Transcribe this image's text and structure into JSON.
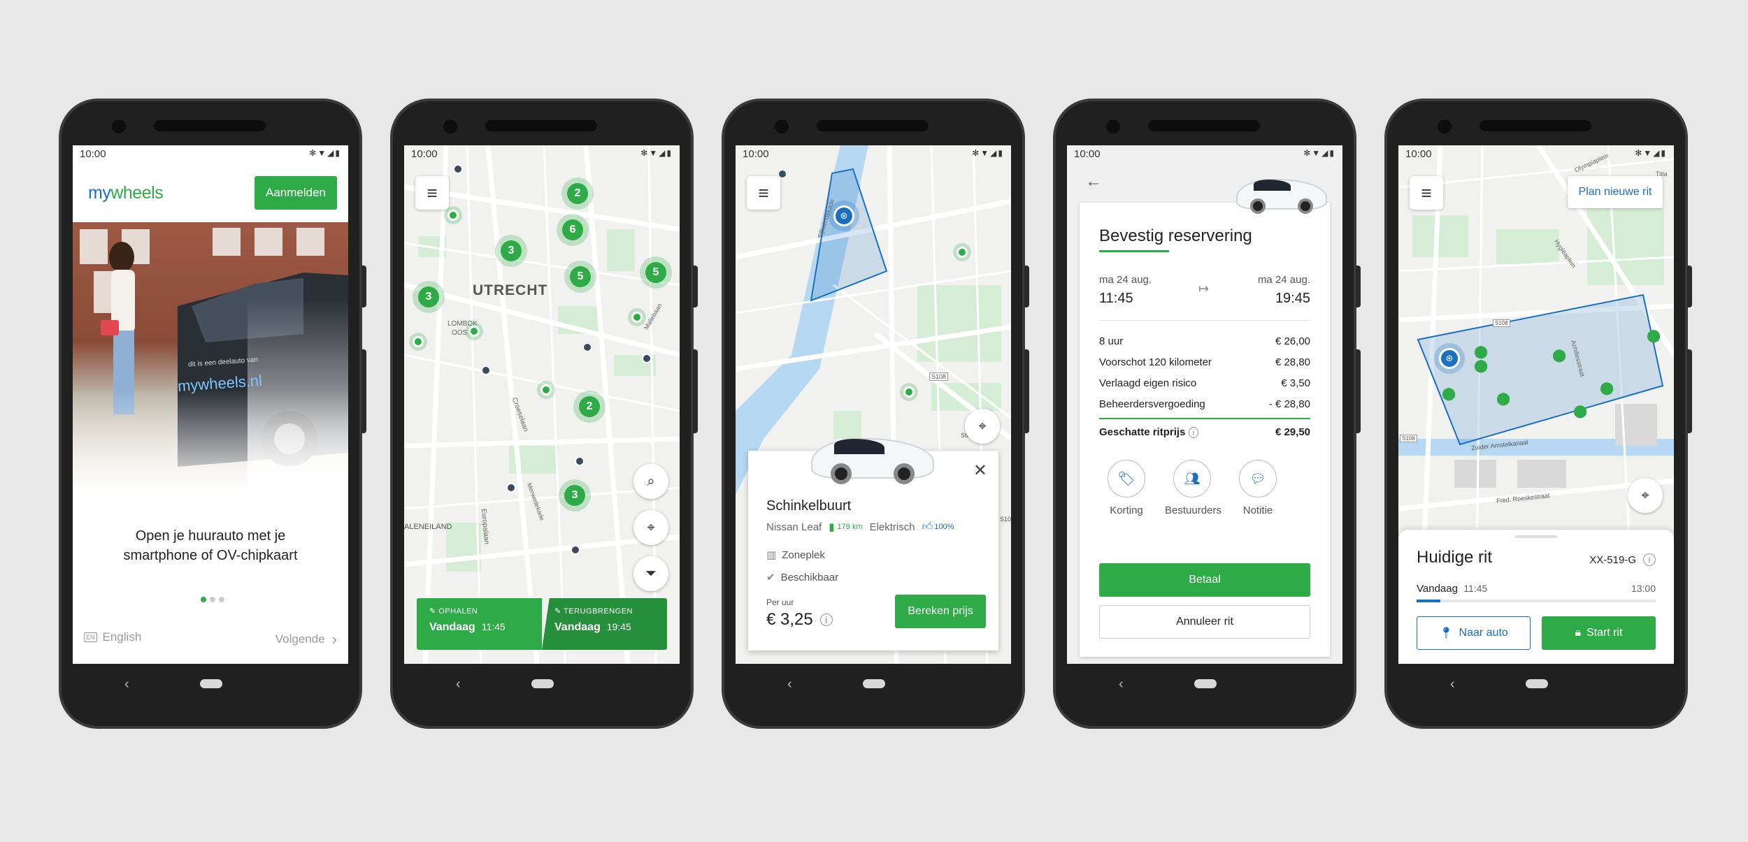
{
  "status_time": "10:00",
  "p1": {
    "logo_part1": "my",
    "logo_part2": "wheels",
    "login_button": "Aanmelden",
    "car_text1": "dit is een deelauto van",
    "car_text2": "mywheels.nl",
    "tagline": "Open je huurauto met je smartphone of OV-chipkaart",
    "lang_badge": "EN",
    "lang_label": "English",
    "next_label": "Volgende"
  },
  "p2": {
    "city_label": "UTRECHT",
    "clusters": [
      "2",
      "6",
      "3",
      "5",
      "5",
      "3",
      "2",
      "3"
    ],
    "street_labels": [
      "LOMBOK",
      "OOST",
      "Croeselaan",
      "Europalaan",
      "Merwedekade",
      "ALENEILAND",
      "Maliebaan"
    ],
    "pickup_label": "OPHALEN",
    "pickup_day": "Vandaag",
    "pickup_time": "11:45",
    "return_label": "TERUGBRENGEN",
    "return_day": "Vandaag",
    "return_time": "19:45"
  },
  "p3": {
    "street_labels": [
      "Sijtwendekade",
      "S108",
      "S10",
      "Sta"
    ],
    "location_name": "Schinkelbuurt",
    "car_model": "Nissan Leaf",
    "range": "179 km",
    "fuel": "Elektrisch",
    "rating": "100%",
    "zone_label": "Zoneplek",
    "availability": "Beschikbaar",
    "price_caption": "Per uur",
    "price": "€ 3,25",
    "calc_button": "Bereken prijs"
  },
  "p4": {
    "title": "Bevestig reservering",
    "start_date": "ma 24 aug.",
    "start_time": "11:45",
    "end_date": "ma 24 aug.",
    "end_time": "19:45",
    "lines": [
      {
        "label": "8 uur",
        "value": "€ 26,00"
      },
      {
        "label": "Voorschot 120 kilometer",
        "value": "€ 28,80"
      },
      {
        "label": "Verlaagd eigen risico",
        "value": "€ 3,50"
      },
      {
        "label": "Beheerdersvergoeding",
        "value": "- € 28,80"
      }
    ],
    "total_label": "Geschatte ritprijs",
    "total_value": "€ 29,50",
    "actions": [
      "Korting",
      "Bestuurders",
      "Notitie"
    ],
    "pay_button": "Betaal",
    "cancel_button": "Annuleer rit"
  },
  "p5": {
    "plan_button": "Plan nieuwe rit",
    "street_labels": [
      "Olympiaplein",
      "Hygiëaplein",
      "Achillesstraat",
      "Zuider Amstelkanaal",
      "Fred. Roeskestraat",
      "S108",
      "S108",
      "Titia"
    ],
    "title": "Huidige rit",
    "plate": "XX-519-G",
    "day": "Vandaag",
    "start_time": "11:45",
    "end_time": "13:00",
    "progress": 0.1,
    "nav_button": "Naar auto",
    "start_button": "Start rit"
  },
  "colors": {
    "brand_green": "#2eaa47",
    "brand_blue": "#1a6fc4",
    "dark_pin": "#3b4a5c"
  }
}
